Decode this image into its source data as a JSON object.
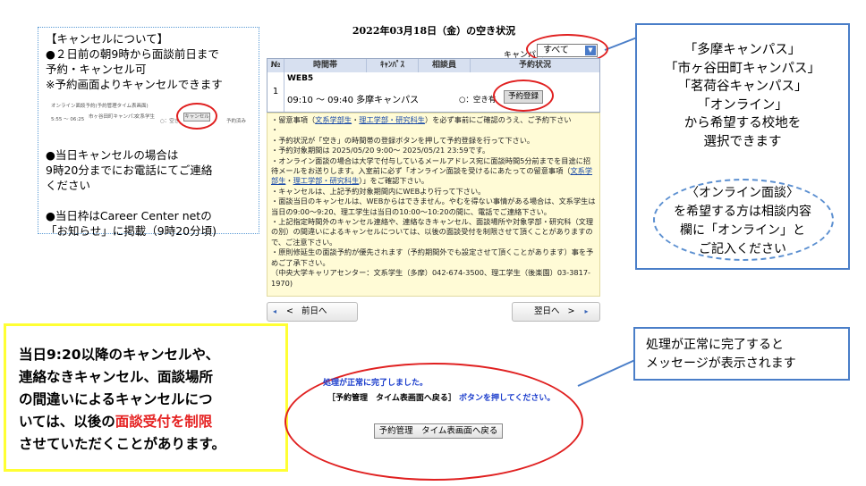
{
  "cancel_note": {
    "lines": [
      "【キャンセルについて】",
      "●２日前の朝9時から面談前日まで",
      "予約・キャンセル可",
      "※予約画面よりキャンセルできます"
    ],
    "mini_screenshot": {
      "header": "オンライン面談予約(予約管理タイム表画面)",
      "time": "5:55 〜 06:25",
      "campus": "市ヶ谷田町キャンパス",
      "subject": "文系学生",
      "status": "○：空き",
      "cancel_label": "キャンセル",
      "reserved": "予約済み"
    },
    "same_day_lines": [
      "●当日キャンセルの場合は",
      "9時20分までにお電話にてご連絡",
      "ください"
    ],
    "info_lines": [
      "●当日枠はCareer Center netの",
      "「お知らせ」に掲載（9時20分頃)"
    ]
  },
  "schedule_page": {
    "title": "2022年03月18日（金）の空き状況",
    "campus_label": "キャンパス",
    "campus_selected": "すべて",
    "columns": [
      "№",
      "時間帯",
      "ｷｬﾝﾊﾟｽ",
      "相談員",
      "予約状況"
    ],
    "row": {
      "no": "1",
      "tag": "WEB5",
      "time": "09:10 〜 09:40 多摩キャンパス",
      "availability": "○：空き有",
      "reserve_label": "予約登録"
    },
    "notice_lines": [
      [
        "・留意事項（",
        "*文系学部生*",
        "・",
        "*理工学部・研究科生*",
        "）を必ず事前にご確認のうえ、ご予約下さい"
      ],
      [
        "・"
      ],
      [
        "・予約状況が「空き」の時間帯の登録ボタンを押して予約登録を行って下さい。"
      ],
      [
        "・予約対象期間は 2025/05/20 9:00〜 2025/05/21 23:59です。"
      ],
      [
        "・オンライン面談の場合は大学で付与しているメールアドレス宛に面談時間5分前までを目途に招待メールをお送りします。入室前に必ず「オンライン面談を受けるにあたっての留意事項（",
        "*文系学部生*",
        "・",
        "*理工学部・研究科生*",
        "）」をご確認下さい。"
      ],
      [
        "・キャンセルは、上記予約対象期間内にWEBより行って下さい。"
      ],
      [
        "・面談当日のキャンセルは、WEBからはできません。やむを得ない事情がある場合は、文系学生は当日の9:00〜9:20、理工学生は当日の10:00〜10:20の間に、電話でご連絡下さい。"
      ],
      [
        "・上記指定時間外のキャンセル連絡や、連絡なきキャンセル、面談場所や対象学部・研究科（文理の別）の間違いによるキャンセルについては、以後の面談受付を制限させて頂くことがありますので、ご注意下さい。"
      ],
      [
        "・原則修延生の面談予約が優先されます（予約期間外でも設定させて頂くことがあります）事を予めご了承下さい。"
      ],
      [
        "（中央大学キャリアセンター：文系学生（多摩）042-674-3500、理工学生（後楽園）03-3817-1970)"
      ]
    ],
    "prev_label": "前日へ",
    "next_label": "翌日へ"
  },
  "campus_callout": {
    "lines": [
      "「多摩キャンパス」",
      "「市ヶ谷田町キャンパス」",
      "「茗荷谷キャンパス」",
      "「オンライン」",
      "から希望する校地を",
      "選択できます"
    ],
    "online_lines": [
      "〈オンライン面談〉",
      "を希望する方は相談内容",
      "欄に「オンライン」と",
      "ご記入ください"
    ]
  },
  "warning_note": {
    "line1": "当日9:20以降のキャンセルや、",
    "line2": "連絡なきキャンセル、面談場所",
    "line3": "の間違いによるキャンセルにつ",
    "line4": "いては、以後の",
    "highlight": "面談受付を制限",
    "line5": "させていただくことがあります。"
  },
  "completion_callout": {
    "line1": "処理が正常に完了すると",
    "line2": "メッセージが表示されます"
  },
  "completion_screen": {
    "message": "処理が正常に完了しました。",
    "instruction_bracket": "［予約管理　タイム表画面へ戻る］",
    "instruction_tail": "ボタンを押してください。",
    "button_label": "予約管理　タイム表画面へ戻る"
  },
  "colors": {
    "red_highlight": "#e52020",
    "callout_blue": "#4a7ec8",
    "notice_bg": "#fffbd6",
    "header_bg": "#d7e0f0",
    "yellow_border": "#ffff33"
  }
}
